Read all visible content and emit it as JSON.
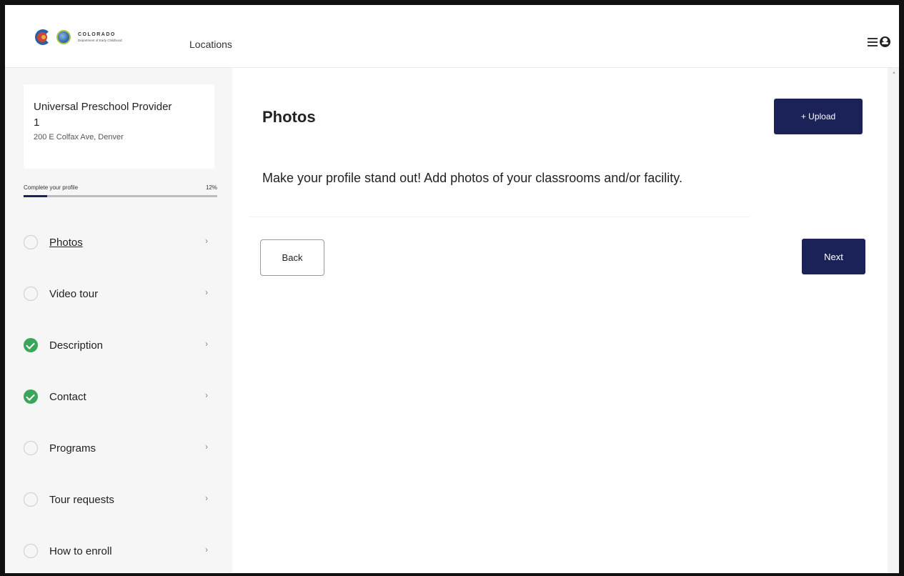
{
  "header": {
    "logo": {
      "line1": "COLORADO",
      "line2": "Department of Early Childhood"
    },
    "nav_locations": "Locations",
    "menu_icon": "hamburger-menu-icon",
    "user_icon": "user-account-icon"
  },
  "sidebar": {
    "provider": {
      "name": "Universal Preschool Provider 1",
      "address": "200 E Colfax Ave, Denver"
    },
    "progress": {
      "label": "Complete your profile",
      "percent_text": "12%",
      "value": 0.12,
      "fill_color": "#1b2258"
    },
    "items": [
      {
        "label": "Photos",
        "complete": false,
        "active": true
      },
      {
        "label": "Video tour",
        "complete": false,
        "active": false
      },
      {
        "label": "Description",
        "complete": true,
        "active": false
      },
      {
        "label": "Contact",
        "complete": true,
        "active": false
      },
      {
        "label": "Programs",
        "complete": false,
        "active": false
      },
      {
        "label": "Tour requests",
        "complete": false,
        "active": false
      },
      {
        "label": "How to enroll",
        "complete": false,
        "active": false
      }
    ],
    "chevron": "›"
  },
  "main": {
    "title": "Photos",
    "upload_label": "+ Upload",
    "intro": "Make your profile stand out! Add photos of your classrooms and/or facility.",
    "back_label": "Back",
    "next_label": "Next"
  },
  "colors": {
    "primary": "#1b2258",
    "success": "#39a65a",
    "sidebar_bg": "#f6f6f6"
  }
}
